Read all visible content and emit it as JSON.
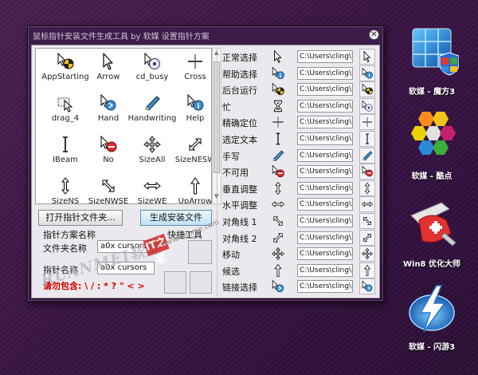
{
  "window": {
    "title": "鼠标指针安装文件生成工具 by 软媒 设置指针方案",
    "close_glyph": "✕"
  },
  "cursor_grid": {
    "items": [
      {
        "label": "AppStarting",
        "icon": "app-starting-icon"
      },
      {
        "label": "Arrow",
        "icon": "arrow-icon"
      },
      {
        "label": "cd_busy",
        "icon": "busy-icon"
      },
      {
        "label": "Cross",
        "icon": "cross-icon"
      },
      {
        "label": "drag_4",
        "icon": "drag-icon"
      },
      {
        "label": "Hand",
        "icon": "hand-icon"
      },
      {
        "label": "Handwriting",
        "icon": "pen-icon"
      },
      {
        "label": "Help",
        "icon": "help-icon"
      },
      {
        "label": "IBeam",
        "icon": "ibeam-icon"
      },
      {
        "label": "No",
        "icon": "no-icon"
      },
      {
        "label": "SizeAll",
        "icon": "size-all-icon"
      },
      {
        "label": "SizeNESW",
        "icon": "size-nesw-icon"
      },
      {
        "label": "SizeNS",
        "icon": "size-ns-icon"
      },
      {
        "label": "SizeNWSE",
        "icon": "size-nwse-icon"
      },
      {
        "label": "SizeWE",
        "icon": "size-we-icon"
      },
      {
        "label": "UpArrow",
        "icon": "up-arrow-icon"
      }
    ]
  },
  "controls": {
    "open_folder_button": "打开指针文件夹...",
    "generate_button": "生成安装文件",
    "shortcut_label": "快捷工具",
    "scheme_section_label": "指针方案名称",
    "folder_name_label": "文件夹名称",
    "folder_name_value": "a0x cursors",
    "pointer_name_label": "指针名称",
    "pointer_name_value": "a0x cursors",
    "warning_text": "请勿包含: \\ / : * ? \" < >"
  },
  "roles": [
    {
      "name": "正常选择",
      "icon": "arrow-icon",
      "path": "C:\\Users\\cling\\D",
      "preview": "arrow-icon"
    },
    {
      "name": "帮助选择",
      "icon": "help-icon",
      "path": "C:\\Users\\cling\\D",
      "preview": "help-icon"
    },
    {
      "name": "后台运行",
      "icon": "app-starting-icon",
      "path": "C:\\Users\\cling\\D",
      "preview": "app-starting-icon"
    },
    {
      "name": "忙",
      "icon": "hourglass-icon",
      "path": "C:\\Users\\cling\\D",
      "preview": "busy-icon"
    },
    {
      "name": "精确定位",
      "icon": "cross-icon",
      "path": "C:\\Users\\cling\\D",
      "preview": "cross-icon"
    },
    {
      "name": "选定文本",
      "icon": "ibeam-icon",
      "path": "C:\\Users\\cling\\D",
      "preview": "ibeam-icon"
    },
    {
      "name": "手写",
      "icon": "pen-icon",
      "path": "C:\\Users\\cling\\D",
      "preview": "pen-icon"
    },
    {
      "name": "不可用",
      "icon": "no-icon",
      "path": "C:\\Users\\cling\\D",
      "preview": "no-icon"
    },
    {
      "name": "垂直调整",
      "icon": "size-ns-icon",
      "path": "C:\\Users\\cling\\D",
      "preview": "size-ns-icon"
    },
    {
      "name": "水平调整",
      "icon": "size-we-icon",
      "path": "C:\\Users\\cling\\D",
      "preview": "size-we-icon"
    },
    {
      "name": "对角线 1",
      "icon": "size-nwse-icon",
      "path": "C:\\Users\\cling\\D",
      "preview": "size-nwse-icon"
    },
    {
      "name": "对角线 2",
      "icon": "size-nesw-icon",
      "path": "C:\\Users\\cling\\D",
      "preview": "size-nesw-icon"
    },
    {
      "name": "移动",
      "icon": "size-all-icon",
      "path": "C:\\Users\\cling\\D",
      "preview": "size-all-icon"
    },
    {
      "name": "候选",
      "icon": "up-arrow-icon",
      "path": "C:\\Users\\cling\\D",
      "preview": "up-arrow-icon"
    },
    {
      "name": "链接选择",
      "icon": "hand-icon",
      "path": "C:\\Users\\cling\\D",
      "preview": "hand-icon"
    }
  ],
  "desktop_icons": [
    {
      "label": "软媒 - 魔方3",
      "icon": "cube-app-icon"
    },
    {
      "label": "软媒 - 酷点",
      "icon": "hexagon-app-icon"
    },
    {
      "label": "Win8 优化大师",
      "icon": "swiss-knife-app-icon"
    },
    {
      "label": "软媒 - 闪游3",
      "icon": "lightning-app-icon"
    }
  ],
  "watermark": {
    "logo_text": "RUANMEI软媒",
    "site_text": "www.ithome.com",
    "badge_text": "IT之家"
  },
  "colors": {
    "desktop_bg": "#3b1544",
    "window_frame": "#2e1238",
    "client_bg": "#ebe9ed",
    "warning": "#d10000",
    "primary_button": "#bfe2f6"
  }
}
